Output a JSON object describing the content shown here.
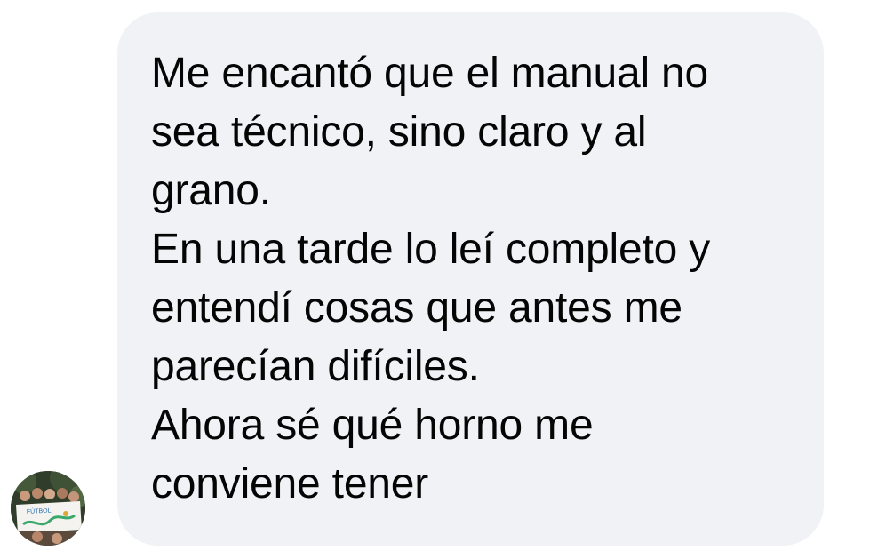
{
  "message": {
    "lines": [
      "Me encantó que el manual no",
      "sea técnico, sino claro y al",
      "grano.",
      "En una tarde lo leí completo y",
      "entendí cosas que antes me",
      "parecían difíciles.",
      "Ahora sé qué horno me",
      "conviene tener"
    ]
  },
  "sender": {
    "avatar_banner_text": "FÚTBOL"
  },
  "colors": {
    "bubble_background": "#f0f2f5",
    "text": "#050505",
    "page_background": "#ffffff"
  }
}
